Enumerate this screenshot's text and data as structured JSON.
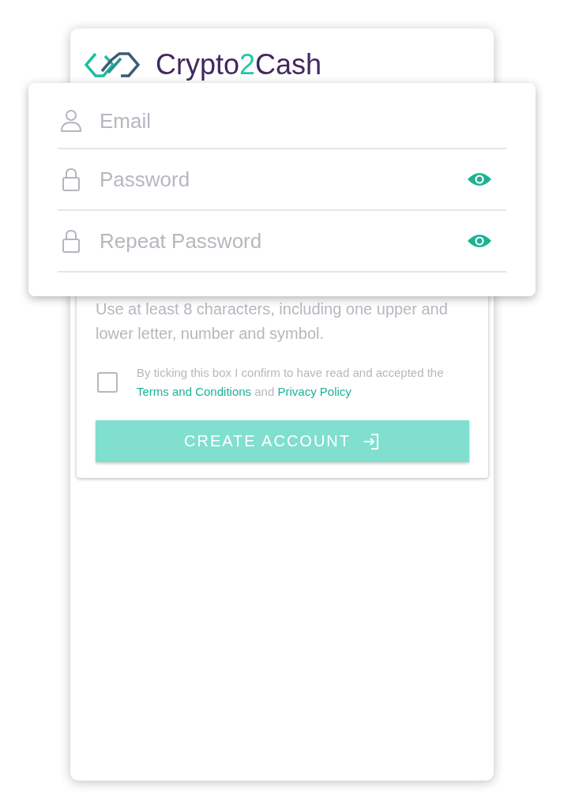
{
  "logo": {
    "parts": [
      {
        "text": "Crypto",
        "kind": "plain"
      },
      {
        "text": "2",
        "kind": "accent"
      },
      {
        "text": "Cash",
        "kind": "plain"
      }
    ]
  },
  "fields": [
    {
      "kind": "email",
      "placeholder": "Email"
    },
    {
      "kind": "password",
      "placeholder": "Password"
    },
    {
      "kind": "password",
      "placeholder": "Repeat Password"
    }
  ],
  "hint": "Use at least 8 characters, including one upper and lower letter, number and symbol.",
  "consent": {
    "checked": false,
    "parts": [
      {
        "kind": "text",
        "text": "By ticking this box I confirm to have read and accepted the "
      },
      {
        "kind": "link",
        "text": "Terms and Conditions"
      },
      {
        "kind": "text",
        "text": " and "
      },
      {
        "kind": "link",
        "text": "Privacy Policy"
      }
    ]
  },
  "button": {
    "label": "CREATE ACCOUNT"
  }
}
